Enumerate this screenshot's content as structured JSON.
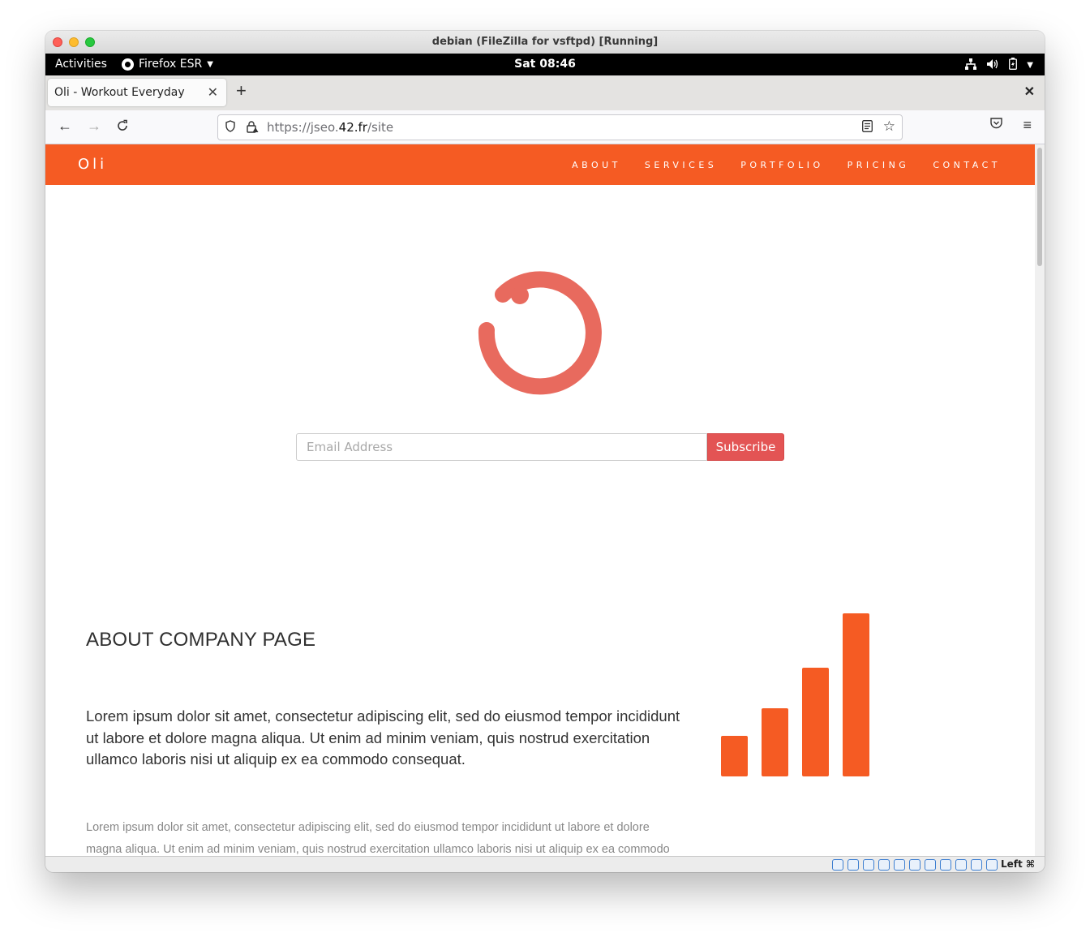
{
  "mac_window": {
    "title": "debian (FileZilla for vsftpd) [Running]"
  },
  "gnome": {
    "activities": "Activities",
    "app_name": "Firefox ESR",
    "clock": "Sat 08:46"
  },
  "firefox": {
    "tab_title": "Oli - Workout Everyday",
    "url_prefix": "https://jseo.",
    "url_domain": "42.fr",
    "url_suffix": "/site"
  },
  "site": {
    "logo": "Oli",
    "nav": [
      "ABOUT",
      "SERVICES",
      "PORTFOLIO",
      "PRICING",
      "CONTACT"
    ],
    "email_placeholder": "Email Address",
    "subscribe_label": "Subscribe",
    "about_title": "ABOUT COMPANY PAGE",
    "about_lead": "Lorem ipsum dolor sit amet, consectetur adipiscing elit, sed do eiusmod tempor incididunt ut labore et dolore magna aliqua. Ut enim ad minim veniam, quis nostrud exercitation ullamco laboris nisi ut aliquip ex ea commodo consequat.",
    "about_body": "Lorem ipsum dolor sit amet, consectetur adipiscing elit, sed do eiusmod tempor incididunt ut labore et dolore magna aliqua. Ut enim ad minim veniam, quis nostrud exercitation ullamco laboris nisi ut aliquip ex ea commodo"
  },
  "vbox": {
    "host_key": "Left ⌘"
  },
  "colors": {
    "brand_orange": "#f55b23",
    "loader": "#e86a5e",
    "subscribe": "#e35454"
  }
}
